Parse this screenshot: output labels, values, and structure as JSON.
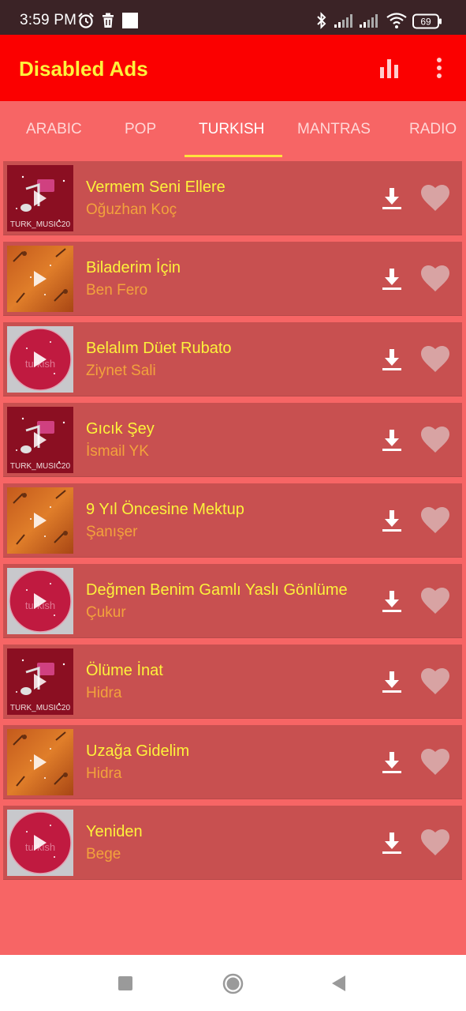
{
  "status_bar": {
    "time": "3:59 PM",
    "battery": "69",
    "icons": [
      "alarm-icon",
      "trash-icon",
      "square-notification-icon",
      "bluetooth-icon",
      "signal-icon",
      "signal-icon",
      "wifi-icon",
      "battery-icon"
    ]
  },
  "app_bar": {
    "title": "Disabled Ads",
    "actions": [
      "equalizer-icon",
      "more-vert-icon"
    ]
  },
  "tabs": [
    {
      "label": "ARABIC"
    },
    {
      "label": "POP"
    },
    {
      "label": "TURKISH",
      "active": true
    },
    {
      "label": "MANTRAS"
    },
    {
      "label": "RADIO"
    }
  ],
  "songs": [
    {
      "title": "Vermem Seni Ellere",
      "artist": "Oğuzhan Koç",
      "thumb": "turk_music",
      "thumb_text": "TURK_MUSIC20"
    },
    {
      "title": "Biladerim İçin",
      "artist": "Ben Fero",
      "thumb": "orange_guitar",
      "thumb_text": ""
    },
    {
      "title": "Belalım Düet Rubato",
      "artist": "Ziynet Sali",
      "thumb": "turkish_circle",
      "thumb_text": "turkish"
    },
    {
      "title": "Gıcık Şey",
      "artist": "İsmail YK",
      "thumb": "turk_music",
      "thumb_text": "TURK_MUSIC20"
    },
    {
      "title": "9 Yıl Öncesine Mektup",
      "artist": "Şanışer",
      "thumb": "orange_guitar",
      "thumb_text": ""
    },
    {
      "title": "Değmen Benim Gamlı Yaslı Gönlüme",
      "artist": "Çukur",
      "thumb": "turkish_circle",
      "thumb_text": "turkish"
    },
    {
      "title": "Ölüme İnat",
      "artist": "Hidra",
      "thumb": "turk_music",
      "thumb_text": "TURK_MUSIC20"
    },
    {
      "title": "Uzağa Gidelim",
      "artist": "Hidra",
      "thumb": "orange_guitar",
      "thumb_text": ""
    },
    {
      "title": "Yeniden",
      "artist": "Bege",
      "thumb": "turkish_circle",
      "thumb_text": "turkish"
    }
  ],
  "row_icons": {
    "download": "download-icon",
    "favorite": "heart-icon"
  },
  "nav_bar": [
    "recents-square-icon",
    "home-circle-icon",
    "back-triangle-icon"
  ],
  "colors": {
    "status_bar": "#3b2326",
    "app_bar": "#fb0000",
    "accent_yellow": "#fdf23b",
    "artist_orange": "#f2a23c",
    "background": "#f76565",
    "row": "#c85050"
  }
}
